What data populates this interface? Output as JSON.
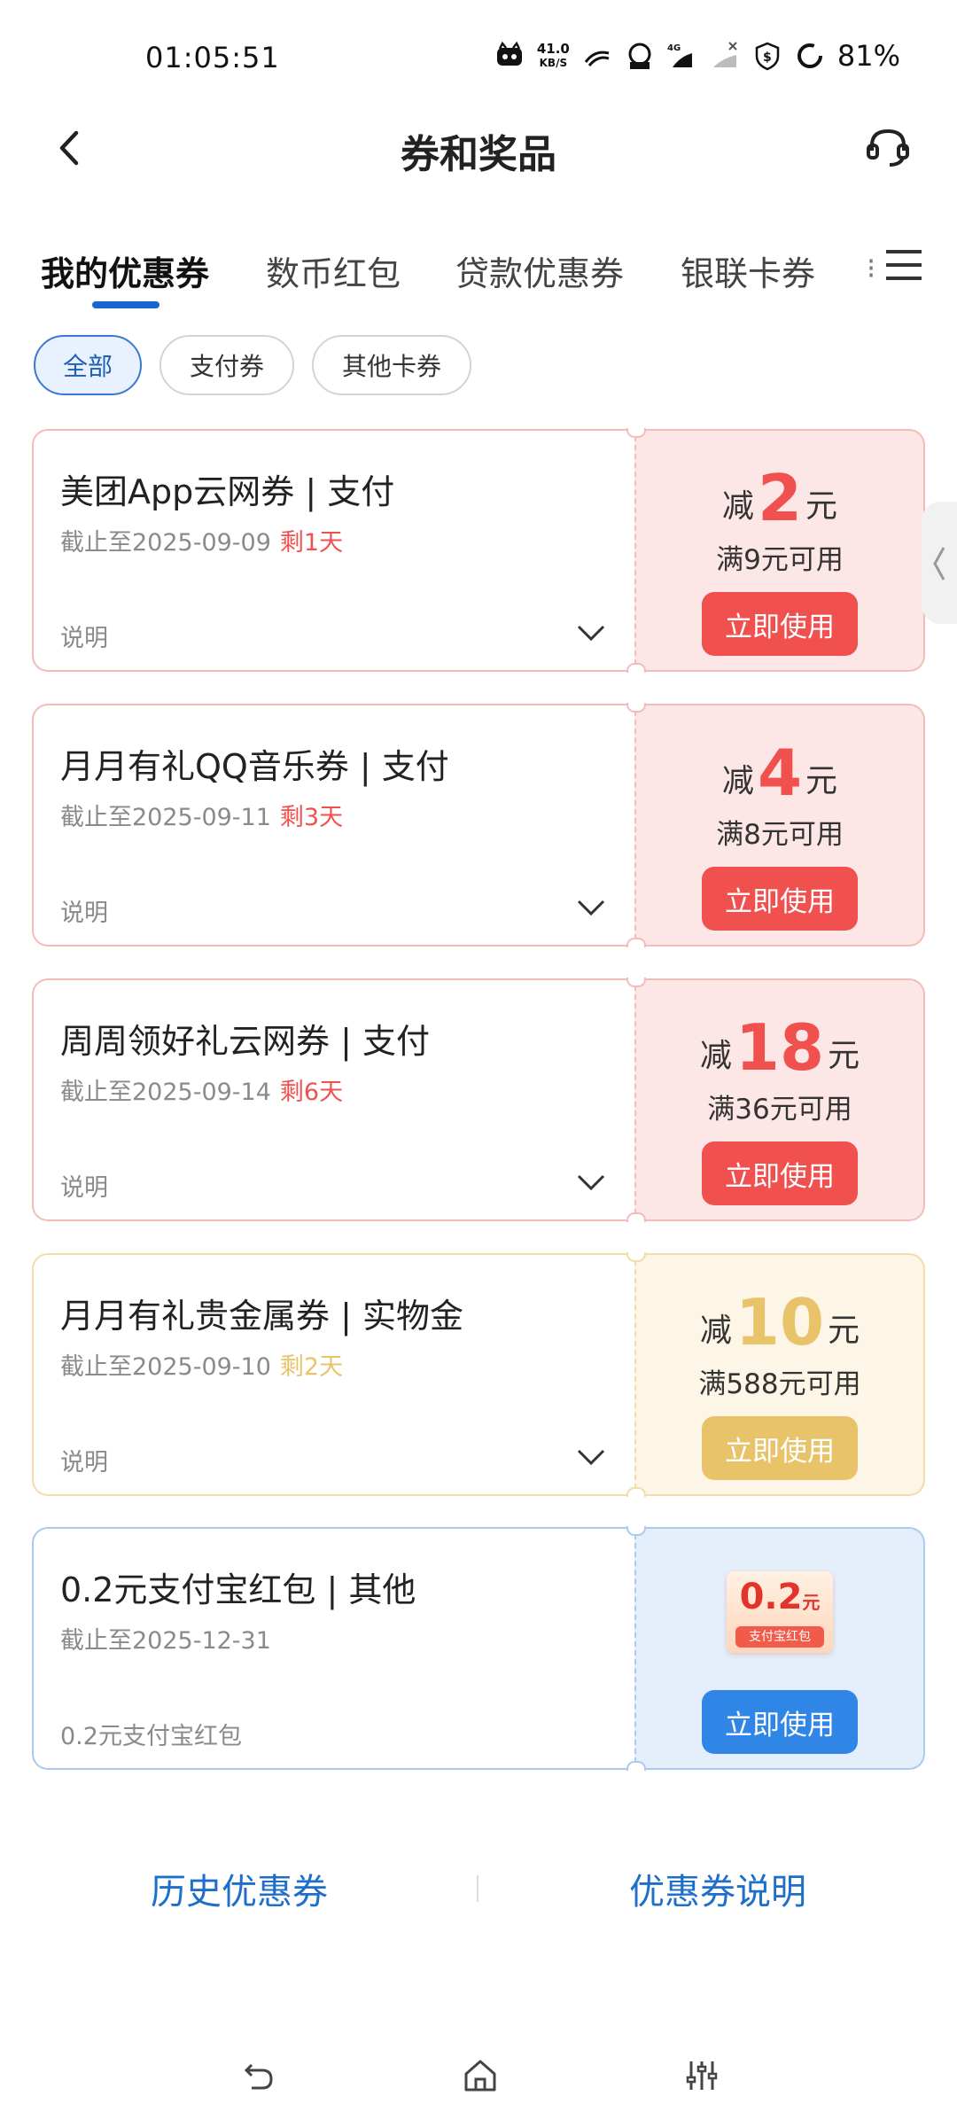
{
  "status": {
    "time": "01:05:51",
    "speed_value": "41.0",
    "speed_unit": "KB/S",
    "battery": "81%"
  },
  "header": {
    "title": "券和奖品"
  },
  "tabs": [
    {
      "label": "我的优惠券"
    },
    {
      "label": "数币红包"
    },
    {
      "label": "贷款优惠券"
    },
    {
      "label": "银联卡券"
    },
    {
      "label": "⁝"
    }
  ],
  "filters": [
    {
      "label": "全部",
      "selected": true
    },
    {
      "label": "支付券",
      "selected": false
    },
    {
      "label": "其他卡券",
      "selected": false
    }
  ],
  "coupons": [
    {
      "title": "美团App云网券 | 支付",
      "date": "截止至2025-09-09",
      "remaining": "剩1天",
      "note": "说明",
      "amount_prefix": "减",
      "amount": "2",
      "amount_unit": "元",
      "condition": "满9元可用",
      "button": "立即使用",
      "theme": "red"
    },
    {
      "title": "月月有礼QQ音乐券 | 支付",
      "date": "截止至2025-09-11",
      "remaining": "剩3天",
      "note": "说明",
      "amount_prefix": "减",
      "amount": "4",
      "amount_unit": "元",
      "condition": "满8元可用",
      "button": "立即使用",
      "theme": "red"
    },
    {
      "title": "周周领好礼云网券 | 支付",
      "date": "截止至2025-09-14",
      "remaining": "剩6天",
      "note": "说明",
      "amount_prefix": "减",
      "amount": "18",
      "amount_unit": "元",
      "condition": "满36元可用",
      "button": "立即使用",
      "theme": "red"
    },
    {
      "title": "月月有礼贵金属券 | 实物金",
      "date": "截止至2025-09-10",
      "remaining": "剩2天",
      "note": "说明",
      "amount_prefix": "减",
      "amount": "10",
      "amount_unit": "元",
      "condition": "满588元可用",
      "button": "立即使用",
      "theme": "gold"
    },
    {
      "title": "0.2元支付宝红包 |  其他",
      "date": "截止至2025-12-31",
      "note": "0.2元支付宝红包",
      "badge_amount": "0.2",
      "badge_unit": "元",
      "badge_label": "支付宝红包",
      "button": "立即使用",
      "theme": "blue"
    }
  ],
  "footer": {
    "history": "历史优惠券",
    "explain": "优惠券说明"
  },
  "colors": {
    "accent": "#1766d0",
    "red_accent": "#f0514f",
    "red_bg": "#fce7e6",
    "red_border": "#f3bcb8",
    "gold_accent": "#e9c36a",
    "gold_bg": "#fdf5e6",
    "gold_border": "#f2dca8",
    "blue_accent": "#2f86e6",
    "blue_bg": "#e4effb",
    "blue_border": "#a9cbee"
  }
}
